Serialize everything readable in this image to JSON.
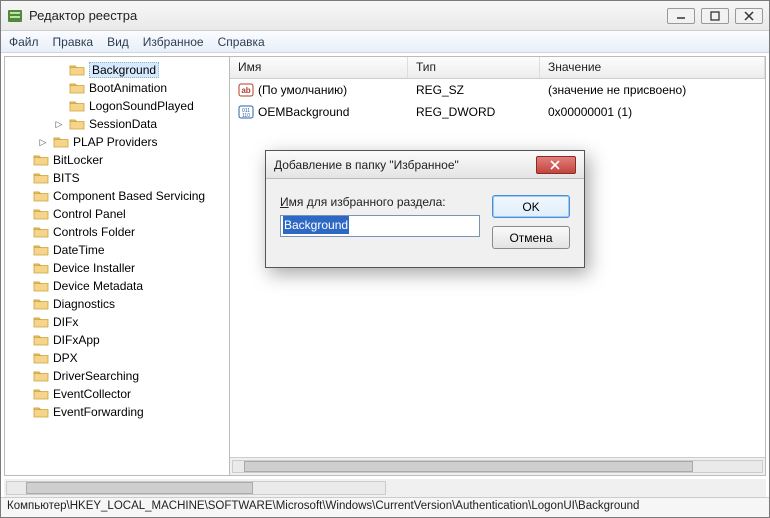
{
  "window": {
    "title": "Редактор реестра"
  },
  "menu": {
    "file": "Файл",
    "edit": "Правка",
    "view": "Вид",
    "favorites": "Избранное",
    "help": "Справка"
  },
  "tree": {
    "items": [
      {
        "label": "Background",
        "indent": 2,
        "expander": "",
        "selected": true
      },
      {
        "label": "BootAnimation",
        "indent": 2,
        "expander": ""
      },
      {
        "label": "LogonSoundPlayed",
        "indent": 2,
        "expander": ""
      },
      {
        "label": "SessionData",
        "indent": 2,
        "expander": "▷"
      },
      {
        "label": "PLAP Providers",
        "indent": 1,
        "expander": "▷"
      },
      {
        "label": "BitLocker",
        "indent": 0,
        "expander": ""
      },
      {
        "label": "BITS",
        "indent": 0,
        "expander": ""
      },
      {
        "label": "Component Based Servicing",
        "indent": 0,
        "expander": ""
      },
      {
        "label": "Control Panel",
        "indent": 0,
        "expander": ""
      },
      {
        "label": "Controls Folder",
        "indent": 0,
        "expander": ""
      },
      {
        "label": "DateTime",
        "indent": 0,
        "expander": ""
      },
      {
        "label": "Device Installer",
        "indent": 0,
        "expander": ""
      },
      {
        "label": "Device Metadata",
        "indent": 0,
        "expander": ""
      },
      {
        "label": "Diagnostics",
        "indent": 0,
        "expander": ""
      },
      {
        "label": "DIFx",
        "indent": 0,
        "expander": ""
      },
      {
        "label": "DIFxApp",
        "indent": 0,
        "expander": ""
      },
      {
        "label": "DPX",
        "indent": 0,
        "expander": ""
      },
      {
        "label": "DriverSearching",
        "indent": 0,
        "expander": ""
      },
      {
        "label": "EventCollector",
        "indent": 0,
        "expander": ""
      },
      {
        "label": "EventForwarding",
        "indent": 0,
        "expander": ""
      }
    ]
  },
  "columns": {
    "name": "Имя",
    "type": "Тип",
    "value": "Значение"
  },
  "values": [
    {
      "icon": "sz",
      "name": "(По умолчанию)",
      "type": "REG_SZ",
      "value": "(значение не присвоено)"
    },
    {
      "icon": "dw",
      "name": "OEMBackground",
      "type": "REG_DWORD",
      "value": "0x00000001 (1)"
    }
  ],
  "status": {
    "path": "Компьютер\\HKEY_LOCAL_MACHINE\\SOFTWARE\\Microsoft\\Windows\\CurrentVersion\\Authentication\\LogonUI\\Background"
  },
  "dialog": {
    "title": "Добавление в папку \"Избранное\"",
    "label_underline": "И",
    "label_rest": "мя для избранного раздела:",
    "input_value": "Background",
    "ok": "OK",
    "cancel": "Отмена"
  }
}
